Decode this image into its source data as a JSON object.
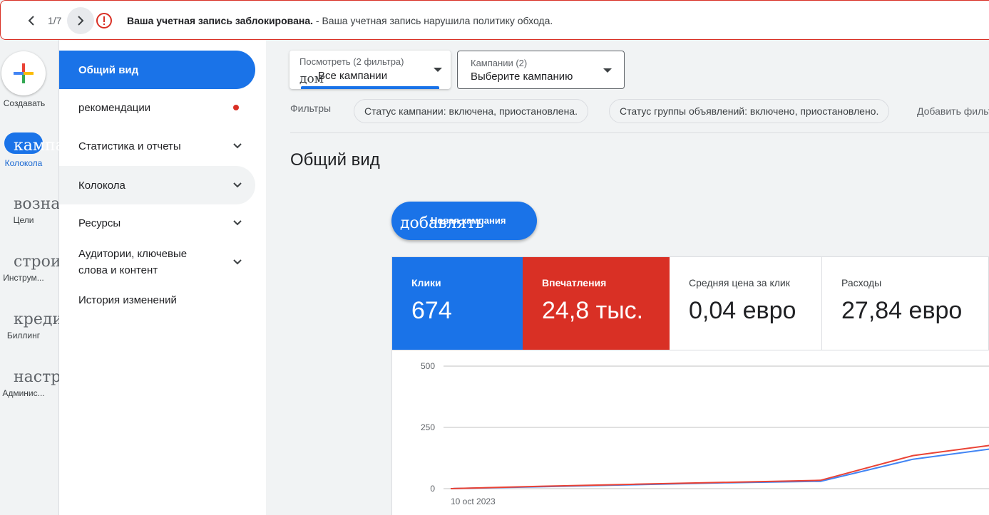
{
  "banner": {
    "pager": "1/7",
    "title": "Ваша учетная запись заблокирована.",
    "message": " - Ваша учетная запись нарушила политику обхода."
  },
  "rail": {
    "create_label": "Создавать",
    "items": [
      {
        "glyph": "кампа",
        "label": "Колокола"
      },
      {
        "glyph": "возна",
        "label": "Цели"
      },
      {
        "glyph": "строи",
        "label": "Инструм..."
      },
      {
        "glyph": "креди",
        "label": "Биллинг"
      },
      {
        "glyph": "настр",
        "label": "Админис..."
      }
    ]
  },
  "sidenav": {
    "items": [
      {
        "label": "Общий вид"
      },
      {
        "label": "рекомендации"
      },
      {
        "label": "Статистика и отчеты"
      },
      {
        "label": "Колокола"
      },
      {
        "label": "Ресурсы"
      },
      {
        "label": "Аудитории, ключевые слова и контент"
      },
      {
        "label": "История изменений"
      }
    ]
  },
  "toolbar": {
    "view": {
      "small": "Посмотреть (2 фильтра)",
      "overlay": "дом",
      "value": "Все кампании"
    },
    "campaigns": {
      "small": "Кампании (2)",
      "value": "Выберите кампанию"
    }
  },
  "filters": {
    "label": "Фильтры",
    "chips": [
      "Статус кампании: включена, приостановлена.",
      "Статус группы объявлений: включено, приостановлено."
    ],
    "add": "Добавить фильтр"
  },
  "page": {
    "title": "Общий вид",
    "new_campaign_glyph": "добавлять",
    "new_campaign_label": "Новая кампания"
  },
  "metrics": [
    {
      "label": "Клики",
      "value": "674"
    },
    {
      "label": "Впечатления",
      "value": "24,8 тыс."
    },
    {
      "label": "Средняя цена за клик",
      "value": "0,04 евро"
    },
    {
      "label": "Расходы",
      "value": "27,84 евро"
    }
  ],
  "colors": {
    "accent": "#1a73e8",
    "alert": "#d93025",
    "clicks_line": "#4285f4",
    "impressions_line": "#ea4335"
  },
  "chart_data": {
    "type": "line",
    "y_ticks": [
      "500",
      "250",
      "0"
    ],
    "ylim": [
      0,
      500
    ],
    "x_labels": [
      "10 oct 2023"
    ],
    "series": [
      {
        "values": [
          0,
          8,
          16,
          24,
          30,
          120,
          170
        ]
      },
      {
        "values": [
          0,
          10,
          18,
          26,
          34,
          135,
          185
        ]
      }
    ]
  }
}
